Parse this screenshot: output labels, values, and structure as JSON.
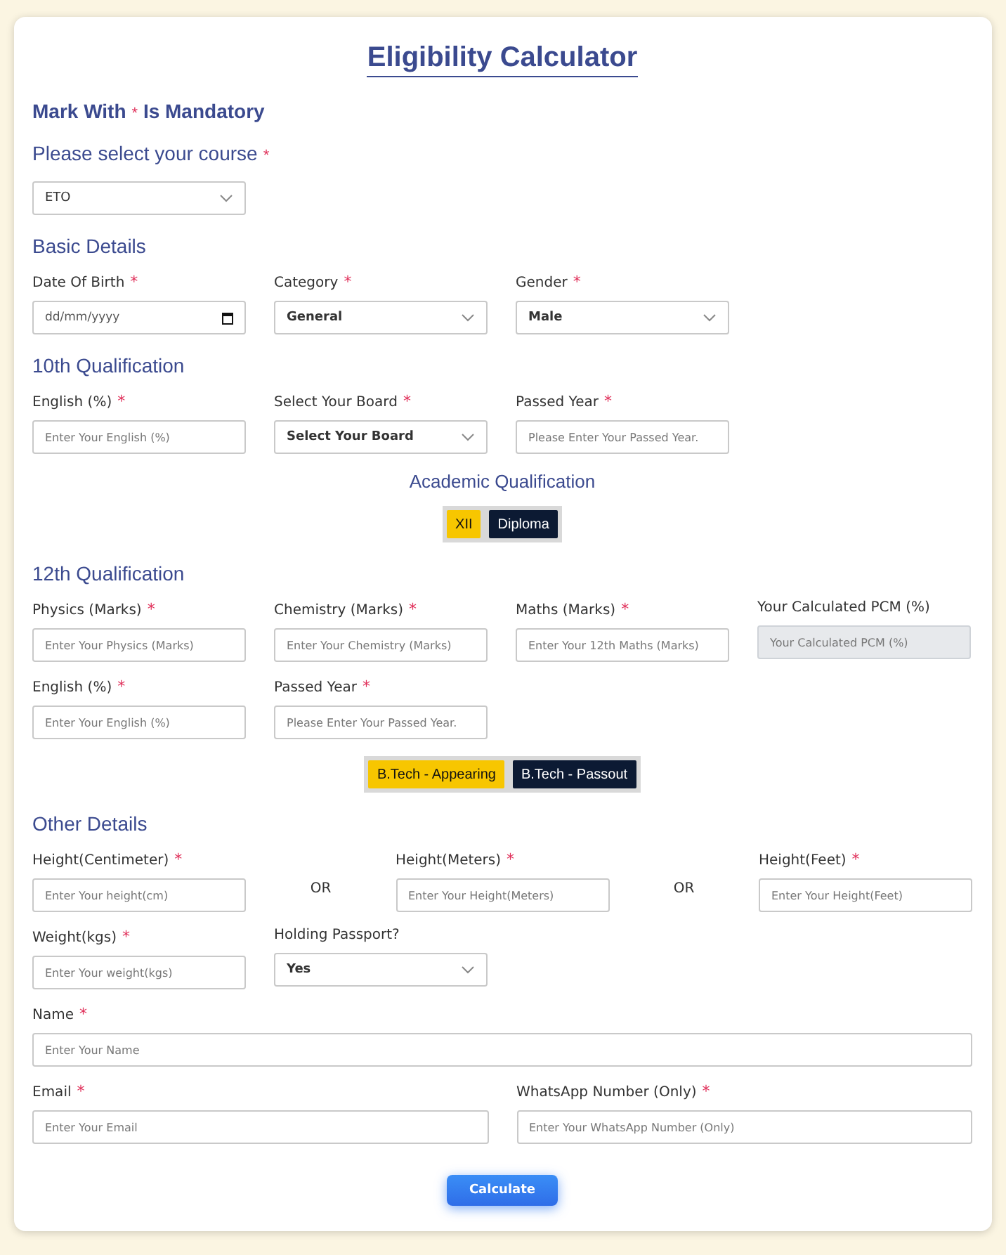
{
  "title": "Eligibility Calculator",
  "required_mark": "*",
  "mandatory_note": {
    "before": "Mark With",
    "after": "Is Mandatory"
  },
  "course": {
    "label": "Please select your course",
    "required": true,
    "value": "ETO"
  },
  "blocks": [
    {
      "kind": "section",
      "heading": "Basic Details",
      "rows": [
        {
          "kind": "quad",
          "fields": [
            {
              "kind": "date",
              "label": "Date Of Birth",
              "required": true,
              "placeholder": "dd/mm/yyyy"
            },
            {
              "kind": "select",
              "label": "Category",
              "required": true,
              "value": "General"
            },
            {
              "kind": "select",
              "label": "Gender",
              "required": true,
              "value": "Male"
            }
          ]
        }
      ]
    },
    {
      "kind": "section",
      "heading": "10th Qualification",
      "rows": [
        {
          "kind": "quad",
          "fields": [
            {
              "kind": "input",
              "label": "English (%)",
              "required": true,
              "placeholder": "Enter Your English (%)"
            },
            {
              "kind": "select",
              "label": "Select Your Board",
              "required": true,
              "value": "Select Your Board"
            },
            {
              "kind": "input",
              "label": "Passed Year",
              "required": true,
              "placeholder": "Please Enter Your Passed Year."
            }
          ]
        }
      ]
    },
    {
      "kind": "toggle",
      "heading": "Academic Qualification",
      "options": [
        {
          "label": "XII",
          "selected": true
        },
        {
          "label": "Diploma",
          "selected": false
        }
      ]
    },
    {
      "kind": "section",
      "heading": "12th Qualification",
      "rows": [
        {
          "kind": "quad",
          "fields": [
            {
              "kind": "input",
              "label": "Physics (Marks)",
              "required": true,
              "placeholder": "Enter Your Physics (Marks)"
            },
            {
              "kind": "input",
              "label": "Chemistry (Marks)",
              "required": true,
              "placeholder": "Enter Your Chemistry (Marks)"
            },
            {
              "kind": "input",
              "label": "Maths (Marks)",
              "required": true,
              "placeholder": "Enter Your 12th Maths (Marks)"
            },
            {
              "kind": "input",
              "label": "Your Calculated PCM (%)",
              "required": false,
              "disabled": true,
              "placeholder": "Your Calculated PCM (%)"
            }
          ]
        },
        {
          "kind": "quad",
          "fields": [
            {
              "kind": "input",
              "label": "English (%)",
              "required": true,
              "placeholder": "Enter Your English (%)"
            },
            {
              "kind": "input",
              "label": "Passed Year",
              "required": true,
              "placeholder": "Please Enter Your Passed Year."
            }
          ]
        }
      ]
    },
    {
      "kind": "toggle",
      "options": [
        {
          "label": "B.Tech - Appearing",
          "selected": true
        },
        {
          "label": "B.Tech - Passout",
          "selected": false
        }
      ]
    },
    {
      "kind": "section",
      "heading": "Other Details",
      "rows": [
        {
          "kind": "or",
          "fields": [
            {
              "kind": "input",
              "label": "Height(Centimeter)",
              "required": true,
              "placeholder": "Enter Your height(cm)"
            },
            {
              "kind": "or",
              "text": "OR"
            },
            {
              "kind": "input",
              "label": "Height(Meters)",
              "required": true,
              "placeholder": "Enter Your Height(Meters)"
            },
            {
              "kind": "or",
              "text": "OR"
            },
            {
              "kind": "input",
              "label": "Height(Feet)",
              "required": true,
              "placeholder": "Enter Your Height(Feet)"
            }
          ]
        },
        {
          "kind": "quad",
          "fields": [
            {
              "kind": "input",
              "label": "Weight(kgs)",
              "required": true,
              "placeholder": "Enter Your weight(kgs)"
            },
            {
              "kind": "select",
              "label": "Holding Passport?",
              "required": false,
              "value": "Yes"
            }
          ]
        },
        {
          "kind": "full",
          "fields": [
            {
              "kind": "input",
              "label": "Name",
              "required": true,
              "placeholder": "Enter Your Name"
            }
          ]
        },
        {
          "kind": "half",
          "fields": [
            {
              "kind": "input",
              "label": "Email",
              "required": true,
              "placeholder": "Enter Your Email"
            },
            {
              "kind": "input",
              "label": "WhatsApp Number (Only)",
              "required": true,
              "placeholder": "Enter Your WhatsApp Number (Only)"
            }
          ]
        }
      ]
    }
  ],
  "submit": "Calculate"
}
